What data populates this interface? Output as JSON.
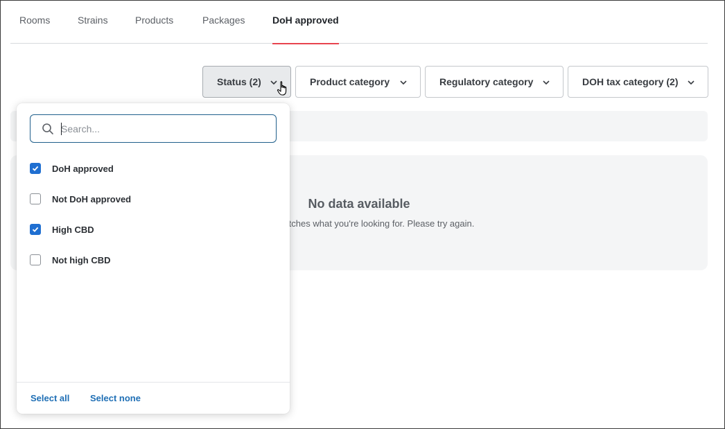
{
  "tabs": [
    {
      "label": "Rooms"
    },
    {
      "label": "Strains"
    },
    {
      "label": "Products"
    },
    {
      "label": "Packages"
    },
    {
      "label": "DoH approved",
      "active": true
    }
  ],
  "filters": {
    "status": "Status (2)",
    "product_category": "Product category",
    "regulatory_category": "Regulatory category",
    "doh_tax_category": "DOH tax category (2)"
  },
  "empty_state": {
    "title": "No data available",
    "description": "ata that matches what you're looking for. Please try again."
  },
  "dropdown": {
    "search_placeholder": "Search...",
    "options": [
      {
        "label": "DoH approved",
        "checked": true
      },
      {
        "label": "Not DoH approved",
        "checked": false
      },
      {
        "label": "High CBD",
        "checked": true
      },
      {
        "label": "Not high CBD",
        "checked": false
      }
    ],
    "select_all": "Select all",
    "select_none": "Select none"
  },
  "colors": {
    "accent": "#1f6fd1",
    "active_tab_underline": "#e8434e",
    "link": "#1f6fb5"
  }
}
